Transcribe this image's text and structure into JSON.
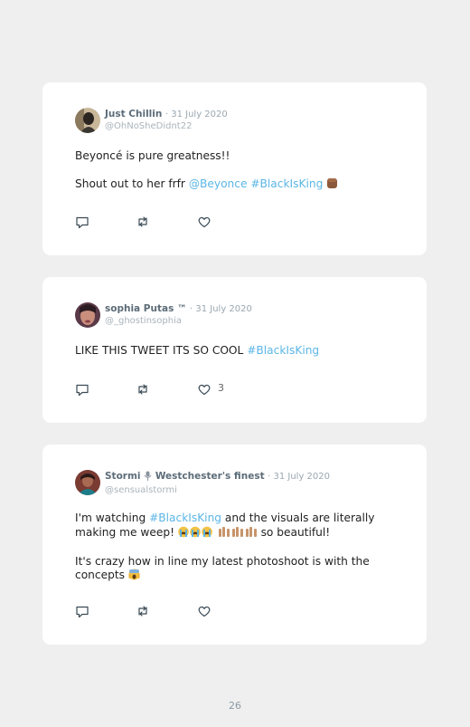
{
  "tweets": [
    {
      "name": "Just Chillin",
      "separator": "·",
      "date": "31 July 2020",
      "handle": "@OhNoSheDidnt22",
      "p1": "Beyoncé is pure greatness!!",
      "p2_text": "Shout out to her frfr ",
      "p2_mention": "@Beyonce",
      "p2_hashtag": "#BlackIsKing",
      "p2_emoji": "raised-fist-emoji",
      "like_count": ""
    },
    {
      "name": "sophia Putas ™",
      "separator": "·",
      "date": "31 July 2020",
      "handle": "@_ghostinsophia",
      "p1_text": "LIKE THIS TWEET ITS SO COOL ",
      "p1_hashtag": "#BlackIsKing",
      "like_count": "3"
    },
    {
      "name": "Stormi",
      "name_rest": "Westchester's finest",
      "separator": "·",
      "date": "31 July 2020",
      "handle": "@sensualstormi",
      "p1_a": "I'm watching ",
      "p1_hashtag": "#BlackIsKing",
      "p1_b": " and the visuals are literally making me weep! ",
      "p1_c": " so beautiful!",
      "p2": "It's crazy how in line my latest photoshoot is with the concepts ",
      "like_count": ""
    }
  ],
  "icons": {
    "reply": "reply-icon",
    "retweet": "retweet-icon",
    "like": "heart-icon"
  },
  "colors": {
    "link": "#5bb6e6",
    "name": "#5c6c78",
    "meta": "#9aa7b0",
    "card": "#ffffff",
    "page": "#efefef"
  },
  "page_number": "26"
}
